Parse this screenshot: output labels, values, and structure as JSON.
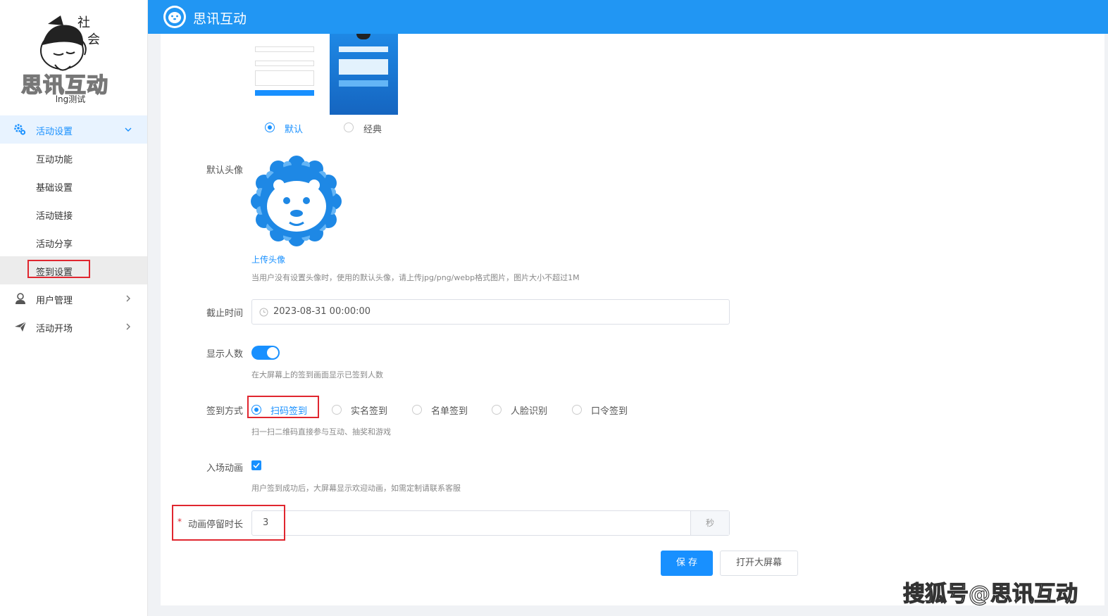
{
  "app": {
    "title": "思讯互动",
    "logo_text": "思讯互动",
    "user_name": "lng测试"
  },
  "sidebar": {
    "group_label": "活动设置",
    "sub_items": [
      {
        "label": "互动功能"
      },
      {
        "label": "基础设置"
      },
      {
        "label": "活动链接"
      },
      {
        "label": "活动分享"
      },
      {
        "label": "签到设置"
      }
    ],
    "items": [
      {
        "label": "用户管理",
        "icon": "user-icon"
      },
      {
        "label": "活动开场",
        "icon": "paper-plane-icon"
      }
    ]
  },
  "form": {
    "theme": {
      "options": [
        {
          "label": "默认",
          "selected": true
        },
        {
          "label": "经典",
          "selected": false
        }
      ]
    },
    "avatar": {
      "label": "默认头像",
      "upload_link": "上传头像",
      "help": "当用户没有设置头像时，使用的默认头像，请上传jpg/png/webp格式图片，图片大小不超过1M"
    },
    "deadline": {
      "label": "截止时间",
      "value": "2023-08-31 00:00:00"
    },
    "show_count": {
      "label": "显示人数",
      "enabled": true,
      "help": "在大屏幕上的签到画面显示已签到人数"
    },
    "checkin_method": {
      "label": "签到方式",
      "options": [
        {
          "label": "扫码签到",
          "selected": true
        },
        {
          "label": "实名签到",
          "selected": false
        },
        {
          "label": "名单签到",
          "selected": false
        },
        {
          "label": "人脸识别",
          "selected": false
        },
        {
          "label": "口令签到",
          "selected": false
        }
      ],
      "help": "扫一扫二维码直接参与互动、抽奖和游戏"
    },
    "entry_animation": {
      "label": "入场动画",
      "checked": true,
      "help": "用户签到成功后，大屏幕显示欢迎动画，如需定制请联系客服"
    },
    "animation_duration": {
      "required_mark": "*",
      "label": "动画停留时长",
      "value": "3",
      "unit": "秒"
    },
    "buttons": {
      "save": "保 存",
      "open_screen": "打开大屏幕"
    }
  },
  "watermark": "搜狐号@思讯互动",
  "colors": {
    "primary": "#1890ff",
    "topbar": "#2196f3",
    "highlight_box": "#e0262f"
  }
}
